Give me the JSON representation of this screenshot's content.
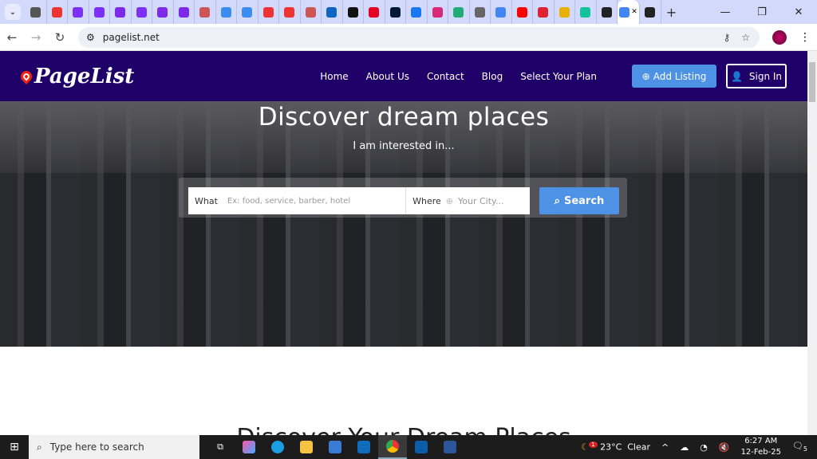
{
  "browser": {
    "tabs": [
      {
        "icon": "globe-icon",
        "color": "#555"
      },
      {
        "icon": "gmail-icon",
        "color": "#e33"
      },
      {
        "icon": "chat-icon",
        "color": "#7b2ff7"
      },
      {
        "icon": "chat-icon",
        "color": "#7b2ff7"
      },
      {
        "icon": "canva-icon",
        "color": "#7d2ae8"
      },
      {
        "icon": "chat-icon",
        "color": "#7b2ff7"
      },
      {
        "icon": "canva-icon",
        "color": "#7d2ae8"
      },
      {
        "icon": "canva-icon",
        "color": "#7d2ae8"
      },
      {
        "icon": "site-icon",
        "color": "#c55"
      },
      {
        "icon": "mail-icon",
        "color": "#3b8ef0"
      },
      {
        "icon": "mail-icon",
        "color": "#3b8ef0"
      },
      {
        "icon": "gmail-icon",
        "color": "#e33"
      },
      {
        "icon": "gmail-icon",
        "color": "#e33"
      },
      {
        "icon": "site-icon",
        "color": "#c55"
      },
      {
        "icon": "linkedin-icon",
        "color": "#0a66c2"
      },
      {
        "icon": "x-icon",
        "color": "#111"
      },
      {
        "icon": "pinterest-icon",
        "color": "#e60023"
      },
      {
        "icon": "tumblr-icon",
        "color": "#001935"
      },
      {
        "icon": "facebook-icon",
        "color": "#1877f2"
      },
      {
        "icon": "instagram-icon",
        "color": "#d62976"
      },
      {
        "icon": "calendar-icon",
        "color": "#2a7"
      },
      {
        "icon": "openai-icon",
        "color": "#666"
      },
      {
        "icon": "google-icon",
        "color": "#4285f4"
      },
      {
        "icon": "youtube-icon",
        "color": "#f00"
      },
      {
        "icon": "tool-icon",
        "color": "#d23"
      },
      {
        "icon": "hat-icon",
        "color": "#e8b000"
      },
      {
        "icon": "grammarly-icon",
        "color": "#15c39a"
      },
      {
        "icon": "openai-icon",
        "color": "#222"
      },
      {
        "icon": "google-icon",
        "color": "#4285f4"
      },
      {
        "icon": "openai-icon",
        "color": "#222"
      }
    ],
    "url": "pagelist.net"
  },
  "site": {
    "logo": "PageList",
    "nav": [
      "Home",
      "About Us",
      "Contact",
      "Blog",
      "Select Your Plan"
    ],
    "add_listing": "Add Listing",
    "sign_in": "Sign In",
    "hero_title": "Discover dream places",
    "hero_sub": "I am interested in...",
    "what_label": "What",
    "what_placeholder": "Ex: food, service, barber, hotel",
    "where_label": "Where",
    "where_placeholder": "Your City...",
    "search_label": "Search",
    "section_title": "Discover Your Dream Places",
    "brand_color": "#1f0068",
    "accent_color": "#4e92e6"
  },
  "taskbar": {
    "search_placeholder": "Type here to search",
    "weather": "23°C  Clear",
    "weather_badge": "1",
    "time": "6:27 AM",
    "date": "12-Feb-25",
    "notifications": "5"
  }
}
